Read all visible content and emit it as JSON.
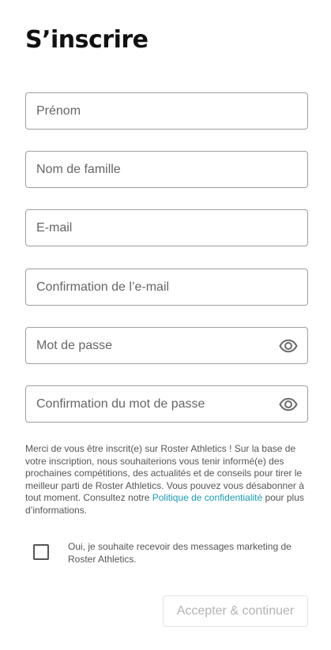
{
  "title": "S’inscrire",
  "fields": {
    "first_name": {
      "placeholder": "Prénom",
      "value": ""
    },
    "last_name": {
      "placeholder": "Nom de famille",
      "value": ""
    },
    "email": {
      "placeholder": "E-mail",
      "value": ""
    },
    "email_confirm": {
      "placeholder": "Confirmation de l’e-mail",
      "value": ""
    },
    "password": {
      "placeholder": "Mot de passe",
      "value": "",
      "icon": "eye-icon"
    },
    "password_confirm": {
      "placeholder": "Confirmation du mot de passe",
      "value": "",
      "icon": "eye-icon"
    }
  },
  "consent": {
    "text_before": "Merci de vous être inscrit(e) sur Roster Athletics ! Sur la base de votre inscription, nous souhaiterions vous tenir informé(e) des prochaines compétitions, des actualités et de conseils pour tirer le meilleur parti de Roster Athletics. Vous pouvez vous désabonner à tout moment. Consultez notre ",
    "link_text": "Politique de confidentialité",
    "text_after": " pour plus d’informations."
  },
  "marketing_checkbox": {
    "label": "Oui, je souhaite recevoir des messages marketing de Roster Athletics.",
    "checked": false
  },
  "submit_label": "Accepter & continuer",
  "colors": {
    "link": "#1a9bb5",
    "border": "#9e9e9e",
    "disabled_text": "#b3b3b3"
  }
}
